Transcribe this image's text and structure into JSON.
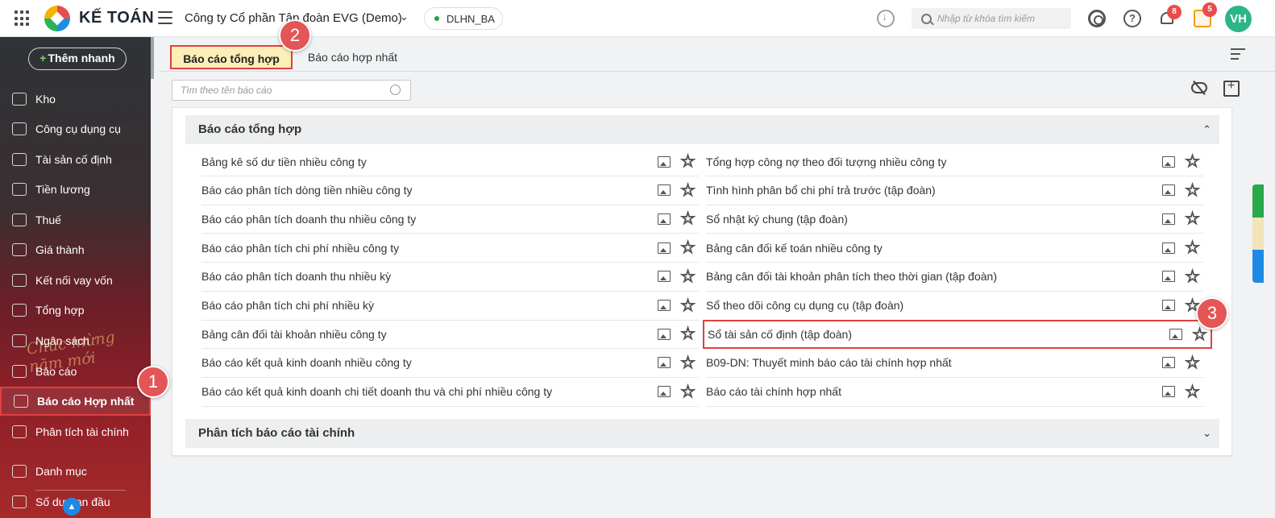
{
  "topbar": {
    "brand": "KẾ TOÁN",
    "company": "Công ty Cổ phần Tập đoàn EVG (Demo)",
    "database": "DLHN_BA",
    "search_placeholder": "Nhập từ khóa tìm kiếm",
    "notification_count": "8",
    "gift_count": "5",
    "avatar_initials": "VH"
  },
  "sidebar": {
    "quick_add": "Thêm nhanh",
    "items": [
      {
        "label": "Kho",
        "icon": "warehouse-icon"
      },
      {
        "label": "Công cụ dụng cụ",
        "icon": "tools-icon"
      },
      {
        "label": "Tài sản cố định",
        "icon": "car-icon"
      },
      {
        "label": "Tiền lương",
        "icon": "payroll-icon"
      },
      {
        "label": "Thuế",
        "icon": "tax-building-icon"
      },
      {
        "label": "Giá thành",
        "icon": "price-tag-icon"
      },
      {
        "label": "Kết nối vay vốn",
        "icon": "loan-icon"
      },
      {
        "label": "Tổng hợp",
        "icon": "summary-icon"
      },
      {
        "label": "Ngân sách",
        "icon": "budget-icon"
      },
      {
        "label": "Báo cáo",
        "icon": "report-chart-icon"
      },
      {
        "label": "Báo cáo Hợp nhất",
        "icon": "consolidated-report-icon"
      },
      {
        "label": "Phân tích tài chính",
        "icon": "financial-analysis-icon"
      },
      {
        "label": "Danh mục",
        "icon": "list-icon"
      },
      {
        "label": "Số dư ban đầu",
        "icon": "opening-balance-icon"
      }
    ],
    "active_index": 10,
    "decoration": "Chúc mừng năm mới"
  },
  "tabs": {
    "active": "Báo cáo tổng hợp",
    "inactive": "Báo cáo hợp nhất"
  },
  "report_search_placeholder": "Tìm theo tên báo cáo",
  "groups": [
    {
      "title": "Báo cáo tổng hợp",
      "expanded": true,
      "left": [
        "Bảng kê số dư tiền nhiều công ty",
        "Báo cáo phân tích dòng tiền nhiều công ty",
        "Báo cáo phân tích doanh thu nhiều công ty",
        "Báo cáo phân tích chi phí nhiều công ty",
        "Báo cáo phân tích doanh thu nhiều kỳ",
        "Báo cáo phân tích chi phí nhiều kỳ",
        "Bảng cân đối tài khoản nhiều công ty",
        "Báo cáo kết quả kinh doanh nhiều công ty",
        "Báo cáo kết quả kinh doanh chi tiết doanh thu và chi phí nhiều công ty"
      ],
      "right": [
        "Tổng hợp công nợ theo đối tượng nhiều công ty",
        "Tình hình phân bổ chi phí trả trước (tập đoàn)",
        "Sổ nhật ký chung (tập đoàn)",
        "Bảng cân đối kế toán nhiều công ty",
        "Bảng cân đối tài khoản phân tích theo thời gian (tập đoàn)",
        "Sổ theo dõi công cụ dụng cụ (tập đoàn)",
        "Sổ tài sản cố định (tập đoàn)",
        "B09-DN: Thuyết minh báo cáo tài chính hợp nhất",
        "Báo cáo tài chính hợp nhất"
      ]
    },
    {
      "title": "Phân tích báo cáo tài chính",
      "expanded": false
    }
  ],
  "callouts": [
    "1",
    "2",
    "3"
  ],
  "colors": {
    "accent_red": "#e04040",
    "active_tab_bg": "#fbeeb6",
    "avatar_bg": "#2db58a",
    "online_dot": "#1fa33c"
  }
}
